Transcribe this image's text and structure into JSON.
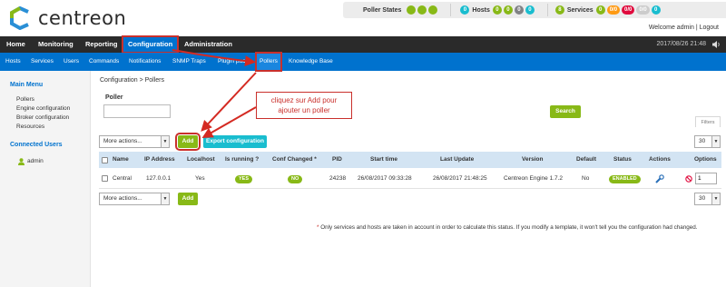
{
  "app": {
    "logo_text": "centreon",
    "brand_color": "#0072ce",
    "accent_green": "#88b917"
  },
  "status_bar": {
    "poller_states_label": "Poller States",
    "hosts_label": "Hosts",
    "hosts_counts": [
      "0",
      "0",
      "0",
      "0",
      "0"
    ],
    "services_label": "Services",
    "services_counts": [
      "8",
      "0",
      "0/0",
      "0/0",
      "0/0",
      "0"
    ]
  },
  "welcome": "Welcome admin | Logout",
  "main_nav": {
    "items": [
      "Home",
      "Monitoring",
      "Reporting",
      "Configuration",
      "Administration"
    ],
    "active": "Configuration",
    "datetime": "2017/08/26 21:48"
  },
  "sub_nav": {
    "items": [
      "Hosts",
      "Services",
      "Users",
      "Commands",
      "Notifications",
      "SNMP Traps",
      "Plugin pack",
      "Pollers",
      "Knowledge Base"
    ],
    "active": "Pollers"
  },
  "sidebar": {
    "main_menu_title": "Main Menu",
    "links": [
      "Pollers",
      "Engine configuration",
      "Broker configuration",
      "Resources"
    ],
    "connected_title": "Connected Users",
    "users": [
      "admin"
    ]
  },
  "breadcrumb": "Configuration  >  Pollers",
  "filter": {
    "label": "Poller",
    "value": "",
    "search_label": "Search",
    "filters_tab": "Filters"
  },
  "toolbar": {
    "more_actions": "More actions...",
    "add_label": "Add",
    "export_label": "Export configuration",
    "page_size": "30"
  },
  "callout": {
    "text_line1": "cliquez sur Add pour",
    "text_line2": "ajouter un poller"
  },
  "table": {
    "headers": [
      "Name",
      "IP Address",
      "Localhost",
      "Is running ?",
      "Conf Changed *",
      "PID",
      "Start time",
      "Last Update",
      "Version",
      "Default",
      "Status",
      "Actions",
      "Options"
    ],
    "rows": [
      {
        "name": "Central",
        "ip": "127.0.0.1",
        "localhost": "Yes",
        "is_running": "YES",
        "conf_changed": "NO",
        "pid": "24238",
        "start_time": "26/08/2017 09:33:28",
        "last_update": "26/08/2017 21:48:25",
        "version": "Centreon Engine 1.7.2",
        "default": "No",
        "status": "ENABLED",
        "options_value": "1"
      }
    ]
  },
  "footnote": {
    "star": "*",
    "text": " Only services and hosts are taken in account in order to calculate this status. If you modify a template, it won't tell you the configuration had changed."
  }
}
